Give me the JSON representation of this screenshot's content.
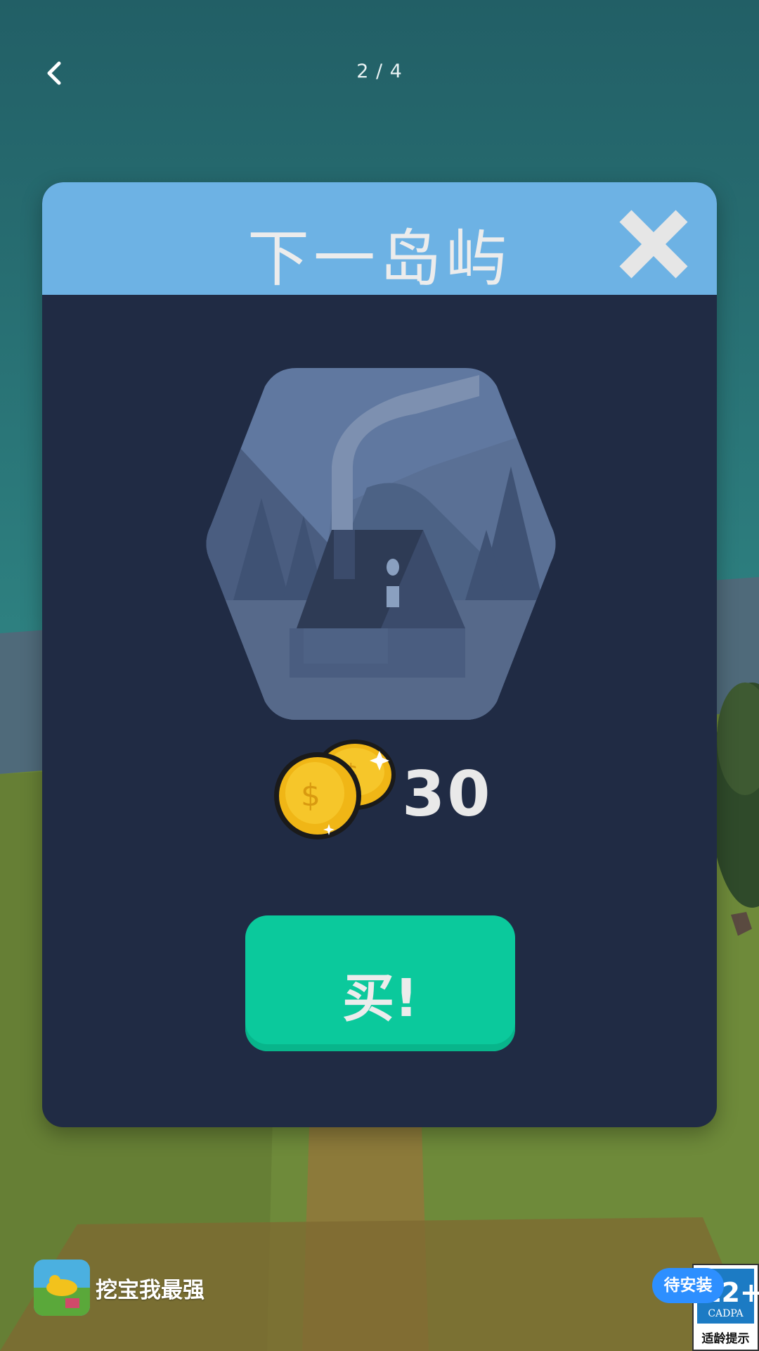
{
  "pager": {
    "text": "2 / 4"
  },
  "modal": {
    "title": "下一岛屿",
    "price": "30",
    "buy_label": "买!"
  },
  "ad": {
    "app_name": "挖宝我最强",
    "install_label": "待安装",
    "age_rating": "12+",
    "age_org": "CADPA",
    "age_caption": "适龄提示"
  },
  "colors": {
    "sky": "#267276",
    "modal_bg": "#202b44",
    "header": "#6db2e4",
    "buy_button": "#0bc99c",
    "grass": "#6e8a3a"
  }
}
